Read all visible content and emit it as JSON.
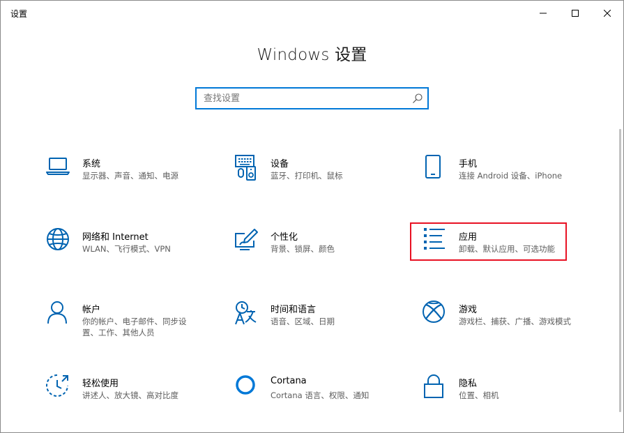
{
  "window": {
    "title": "设置"
  },
  "header": {
    "title": "Windows 设置"
  },
  "search": {
    "placeholder": "查找设置"
  },
  "tiles": [
    {
      "name": "系统",
      "desc": "显示器、声音、通知、电源",
      "icon": "laptop-icon"
    },
    {
      "name": "设备",
      "desc": "蓝牙、打印机、鼠标",
      "icon": "devices-icon"
    },
    {
      "name": "手机",
      "desc": "连接 Android 设备、iPhone",
      "icon": "phone-icon"
    },
    {
      "name": "网络和 Internet",
      "desc": "WLAN、飞行模式、VPN",
      "icon": "globe-icon"
    },
    {
      "name": "个性化",
      "desc": "背景、锁屏、颜色",
      "icon": "personalization-icon"
    },
    {
      "name": "应用",
      "desc": "卸载、默认应用、可选功能",
      "icon": "apps-list-icon"
    },
    {
      "name": "帐户",
      "desc": "你的帐户、电子邮件、同步设置、工作、其他人员",
      "icon": "person-icon"
    },
    {
      "name": "时间和语言",
      "desc": "语音、区域、日期",
      "icon": "time-language-icon"
    },
    {
      "name": "游戏",
      "desc": "游戏栏、捕获、广播、游戏模式",
      "icon": "xbox-icon"
    },
    {
      "name": "轻松使用",
      "desc": "讲述人、放大镜、高对比度",
      "icon": "ease-of-access-icon"
    },
    {
      "name": "Cortana",
      "desc": "Cortana 语言、权限、通知",
      "icon": "cortana-icon"
    },
    {
      "name": "隐私",
      "desc": "位置、相机",
      "icon": "lock-icon"
    }
  ],
  "colors": {
    "accent": "#0078d7",
    "highlight": "#e81123"
  }
}
